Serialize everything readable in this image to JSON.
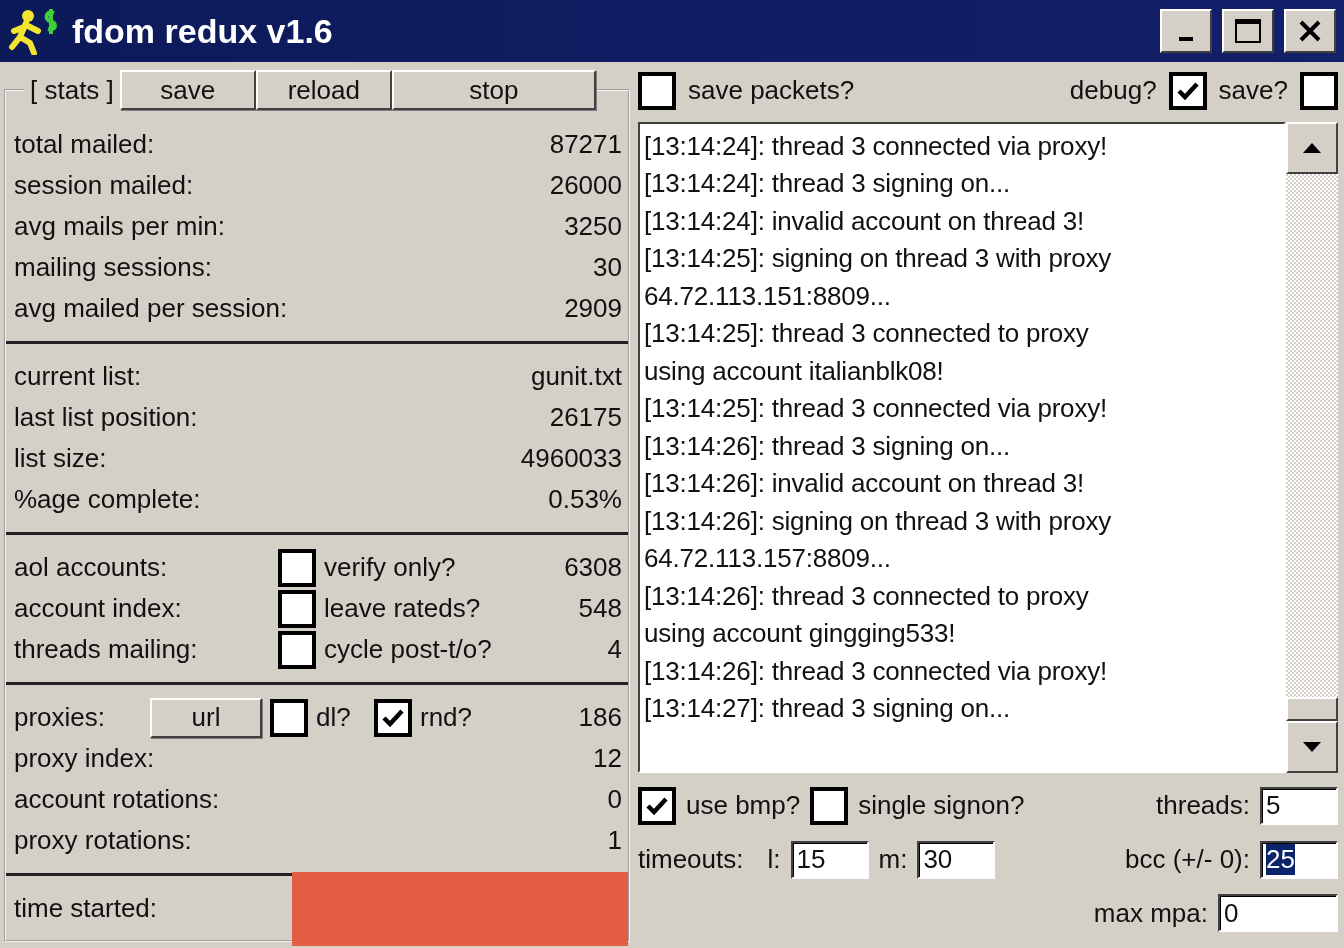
{
  "window": {
    "title": "fdom redux v1.6",
    "controls": [
      {
        "kind": "minimize"
      },
      {
        "kind": "maximize"
      },
      {
        "kind": "close"
      }
    ]
  },
  "stats": {
    "legend": "[ stats ]",
    "buttons": [
      "save",
      "reload",
      "stop"
    ],
    "sections": [
      {
        "rows": [
          {
            "label": "total mailed:",
            "value": "87271"
          },
          {
            "label": "session mailed:",
            "value": "26000"
          },
          {
            "label": "avg mails per min:",
            "value": "3250"
          },
          {
            "label": "mailing sessions:",
            "value": "30"
          },
          {
            "label": "avg mailed per session:",
            "value": "2909"
          }
        ]
      },
      {
        "rows": [
          {
            "label": "current list:",
            "value": "gunit.txt"
          },
          {
            "label": "last list position:",
            "value": "26175"
          },
          {
            "label": "list size:",
            "value": "4960033"
          },
          {
            "label": "%age complete:",
            "value": "0.53%"
          }
        ]
      },
      {
        "rows": [
          {
            "label": "aol accounts:",
            "options": [
              {
                "label": "verify only?",
                "checked": false
              }
            ],
            "value": "6308"
          },
          {
            "label": "account index:",
            "options": [
              {
                "label": "leave rateds?",
                "checked": false
              }
            ],
            "value": "548"
          },
          {
            "label": "threads mailing:",
            "options": [
              {
                "label": "cycle post-t/o?",
                "checked": false
              }
            ],
            "value": "4"
          }
        ]
      },
      {
        "rows": [
          {
            "label": "proxies:",
            "button": "url",
            "options": [
              {
                "label": "dl?",
                "checked": false
              },
              {
                "label": "rnd?",
                "checked": true
              }
            ],
            "value": "186"
          },
          {
            "label": "proxy index:",
            "value": "12"
          },
          {
            "label": "account rotations:",
            "value": "0"
          },
          {
            "label": "proxy rotations:",
            "value": "1"
          }
        ]
      },
      {
        "rows": [
          {
            "label": "time started:",
            "redacted": true
          }
        ]
      }
    ]
  },
  "top_options": [
    {
      "kind": "box_first",
      "label": "save packets?",
      "checked": false
    },
    {
      "kind": "label_first",
      "label": "debug?",
      "checked": true
    },
    {
      "kind": "label_first",
      "label": "save?",
      "checked": false
    }
  ],
  "log": {
    "lines": [
      "[13:14:24]: thread 3 connected via proxy!",
      "[13:14:24]: thread 3 signing on...",
      "[13:14:24]: invalid account on thread 3!",
      "[13:14:25]: signing on thread 3 with proxy",
      "64.72.113.151:8809...",
      "[13:14:25]: thread 3 connected to proxy",
      "using account italianblk08!",
      "[13:14:25]: thread 3 connected via proxy!",
      "[13:14:26]: thread 3 signing on...",
      "[13:14:26]: invalid account on thread 3!",
      "[13:14:26]: signing on thread 3 with proxy",
      "64.72.113.157:8809...",
      "[13:14:26]: thread 3 connected to proxy",
      "using account gingging533!",
      "[13:14:26]: thread 3 connected via proxy!",
      "[13:14:27]: thread 3 signing on..."
    ]
  },
  "bottom_options": [
    {
      "label": "use bmp?",
      "checked": true
    },
    {
      "label": "single signon?",
      "checked": false
    }
  ],
  "threads": {
    "label": "threads:",
    "value": "5"
  },
  "timeouts": {
    "label": "timeouts:",
    "fields": [
      {
        "label": "l:",
        "value": "15"
      },
      {
        "label": "m:",
        "value": "30"
      }
    ]
  },
  "bcc": {
    "label": "bcc (+/- 0):",
    "value": "25",
    "selected": true
  },
  "max_mpa": {
    "label": "max mpa:",
    "value": "0"
  }
}
